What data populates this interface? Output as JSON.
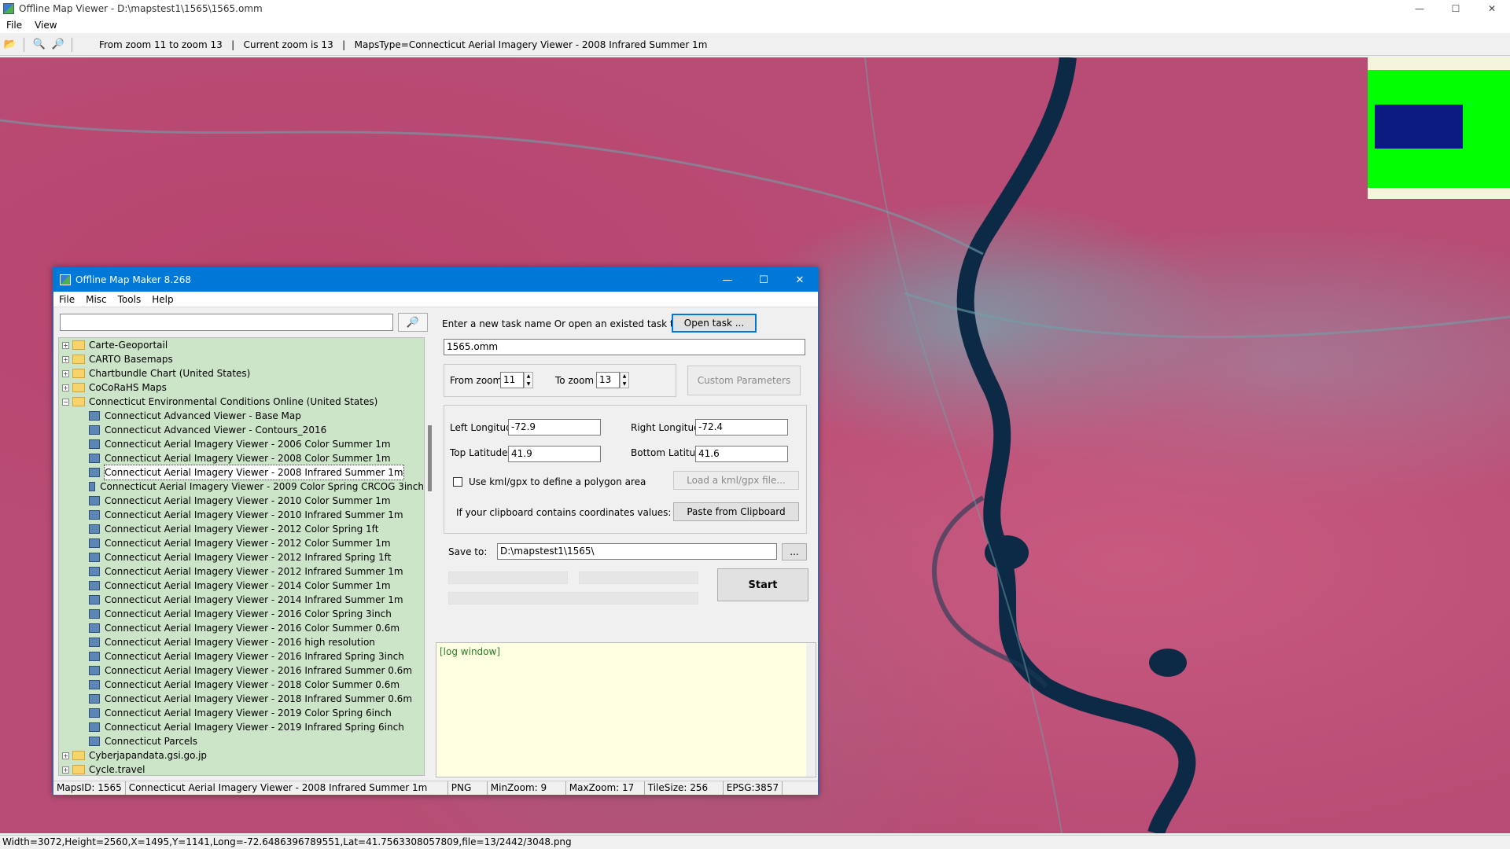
{
  "window": {
    "title": "Offline Map Viewer - D:\\mapstest1\\1565\\1565.omm",
    "min": "—",
    "max": "☐",
    "close": "✕"
  },
  "menu": [
    "File",
    "View"
  ],
  "toolbar": {
    "info": "From zoom 11 to zoom 13   |   Current zoom is 13   |   MapsType=Connecticut Aerial Imagery Viewer - 2008 Infrared Summer 1m",
    "icons": [
      "open-folder-icon",
      "zoom-out-icon",
      "zoom-in-icon"
    ]
  },
  "statusbar": "Width=3072,Height=2560,X=1495,Y=1141,Long=-72.6486396789551,Lat=41.7563308057809,file=13/2442/3048.png",
  "dialog": {
    "title": "Offline Map Maker 8.268",
    "menu": [
      "File",
      "Misc",
      "Tools",
      "Help"
    ],
    "search_placeholder": "",
    "tree": [
      {
        "label": "Carte-Geoportail",
        "type": "folder",
        "expanded": false
      },
      {
        "label": "CARTO Basemaps",
        "type": "folder",
        "expanded": false
      },
      {
        "label": "Chartbundle Chart (United States)",
        "type": "folder",
        "expanded": false
      },
      {
        "label": "CoCoRaHS Maps",
        "type": "folder",
        "expanded": false
      },
      {
        "label": "Connecticut Environmental Conditions Online (United States)",
        "type": "folder",
        "expanded": true
      },
      {
        "label": "Connecticut Advanced Viewer - Base Map",
        "type": "leaf"
      },
      {
        "label": "Connecticut Advanced Viewer - Contours_2016",
        "type": "leaf"
      },
      {
        "label": "Connecticut Aerial Imagery Viewer - 2006 Color Summer 1m",
        "type": "leaf"
      },
      {
        "label": "Connecticut Aerial Imagery Viewer - 2008 Color Summer 1m",
        "type": "leaf"
      },
      {
        "label": "Connecticut Aerial Imagery Viewer - 2008 Infrared Summer 1m",
        "type": "leaf",
        "selected": true
      },
      {
        "label": "Connecticut Aerial Imagery Viewer - 2009 Color Spring CRCOG 3inch",
        "type": "leaf"
      },
      {
        "label": "Connecticut Aerial Imagery Viewer - 2010 Color Summer 1m",
        "type": "leaf"
      },
      {
        "label": "Connecticut Aerial Imagery Viewer - 2010 Infrared Summer 1m",
        "type": "leaf"
      },
      {
        "label": "Connecticut Aerial Imagery Viewer - 2012 Color Spring 1ft",
        "type": "leaf"
      },
      {
        "label": "Connecticut Aerial Imagery Viewer - 2012 Color Summer 1m",
        "type": "leaf"
      },
      {
        "label": "Connecticut Aerial Imagery Viewer - 2012 Infrared Spring 1ft",
        "type": "leaf"
      },
      {
        "label": "Connecticut Aerial Imagery Viewer - 2012 Infrared Summer 1m",
        "type": "leaf"
      },
      {
        "label": "Connecticut Aerial Imagery Viewer - 2014 Color Summer 1m",
        "type": "leaf"
      },
      {
        "label": "Connecticut Aerial Imagery Viewer - 2014 Infrared Summer 1m",
        "type": "leaf"
      },
      {
        "label": "Connecticut Aerial Imagery Viewer - 2016 Color Spring 3inch",
        "type": "leaf"
      },
      {
        "label": "Connecticut Aerial Imagery Viewer - 2016 Color Summer 0.6m",
        "type": "leaf"
      },
      {
        "label": "Connecticut Aerial Imagery Viewer - 2016 high resolution",
        "type": "leaf"
      },
      {
        "label": "Connecticut Aerial Imagery Viewer - 2016 Infrared Spring 3inch",
        "type": "leaf"
      },
      {
        "label": "Connecticut Aerial Imagery Viewer - 2016 Infrared Summer 0.6m",
        "type": "leaf"
      },
      {
        "label": "Connecticut Aerial Imagery Viewer - 2018 Color Summer 0.6m",
        "type": "leaf"
      },
      {
        "label": "Connecticut Aerial Imagery Viewer - 2018 Infrared Summer 0.6m",
        "type": "leaf"
      },
      {
        "label": "Connecticut Aerial Imagery Viewer - 2019 Color Spring 6inch",
        "type": "leaf"
      },
      {
        "label": "Connecticut Aerial Imagery Viewer - 2019 Infrared Spring 6inch",
        "type": "leaf"
      },
      {
        "label": "Connecticut Parcels",
        "type": "leaf"
      },
      {
        "label": "Cyberjapandata.gsi.go.jp",
        "type": "folder",
        "expanded": false
      },
      {
        "label": "Cycle.travel",
        "type": "folder",
        "expanded": false
      }
    ],
    "task_prompt": "Enter a new task name Or open an existed task to continue:",
    "open_task": "Open task ...",
    "task_name": "1565.omm",
    "from_zoom_label": "From zoom",
    "from_zoom": "11",
    "to_zoom_label": "To zoom",
    "to_zoom": "13",
    "custom_params": "Custom Parameters",
    "left_lon_label": "Left Longitude",
    "left_lon": "-72.9",
    "right_lon_label": "Right Longitude",
    "right_lon": "-72.4",
    "top_lat_label": "Top Latitude",
    "top_lat": "41.9",
    "bottom_lat_label": "Bottom Latitude",
    "bottom_lat": "41.6",
    "kml_check_label": "Use kml/gpx to define a polygon area",
    "load_kml": "Load a kml/gpx file...",
    "clipboard_label": "If your clipboard contains coordinates values:",
    "paste_clipboard": "Paste from Clipboard",
    "save_to_label": "Save to:",
    "save_to": "D:\\mapstest1\\1565\\",
    "browse": "...",
    "start": "Start",
    "log": "[log window]",
    "status": [
      "MapsID: 1565",
      "Connecticut Aerial Imagery Viewer - 2008 Infrared Summer 1m",
      "PNG",
      "MinZoom: 9",
      "MaxZoom: 17",
      "TileSize: 256",
      "EPSG:3857"
    ]
  },
  "colors": {
    "accent": "#0078d7",
    "tree_bg": "#cce4c8",
    "map": "#b84c74",
    "river": "#0c2a45",
    "overview_green": "#00ff00",
    "overview_blue": "#0a1a80"
  }
}
